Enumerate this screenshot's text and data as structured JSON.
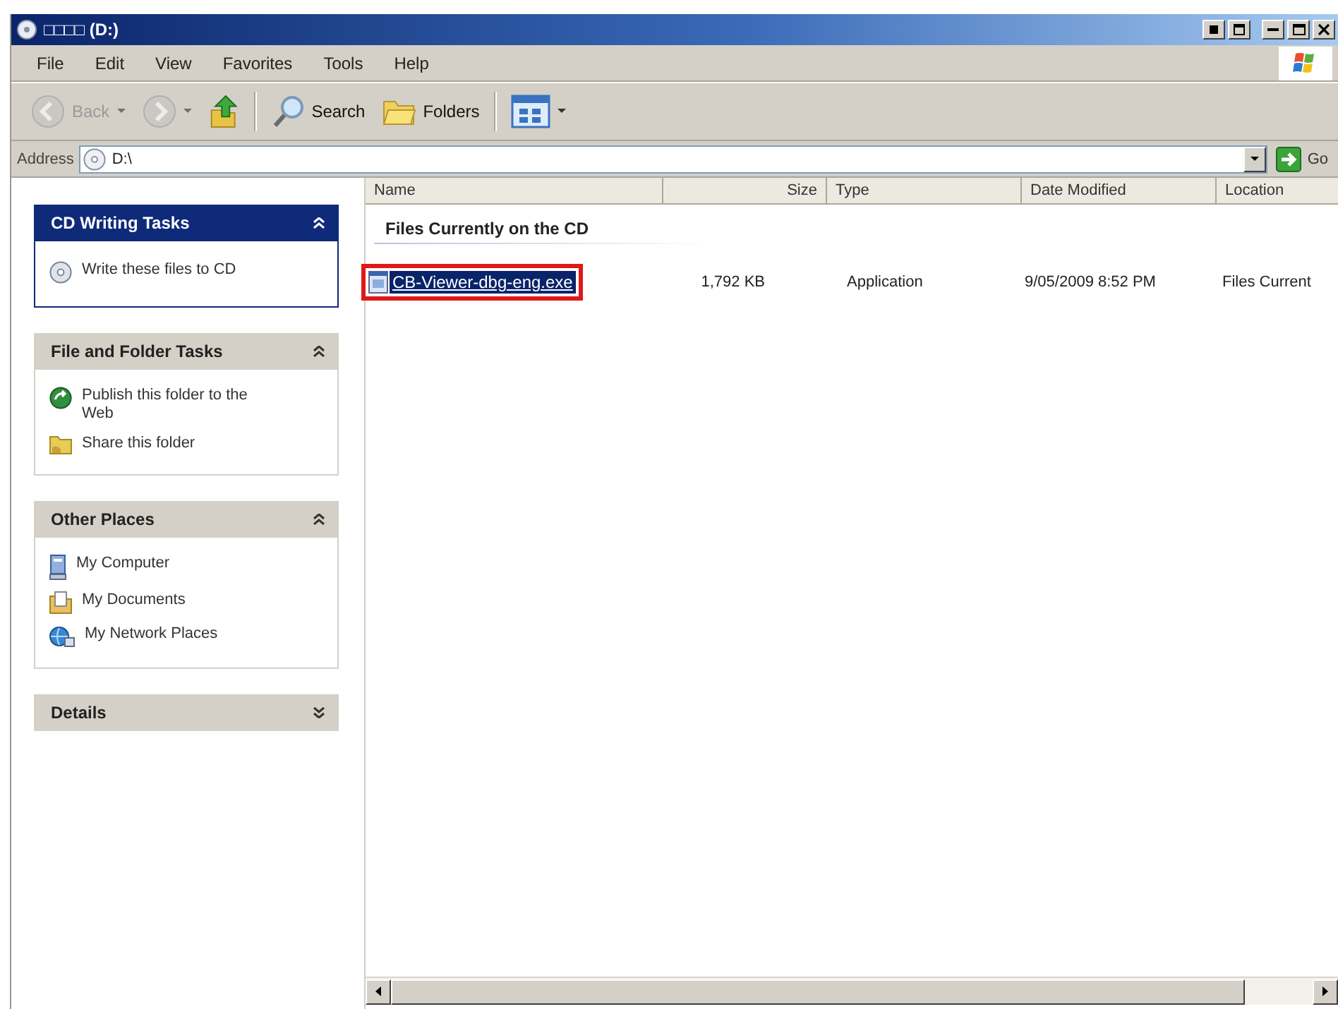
{
  "window": {
    "title": "□□□□ (D:)"
  },
  "menu": [
    "File",
    "Edit",
    "View",
    "Favorites",
    "Tools",
    "Help"
  ],
  "toolbar": [
    {
      "kind": "back",
      "label": "Back",
      "disabled": true
    },
    {
      "kind": "forward",
      "disabled": true
    },
    {
      "kind": "up",
      "disabled": false
    },
    {
      "kind": "search",
      "label": "Search",
      "disabled": false
    },
    {
      "kind": "folders",
      "label": "Folders",
      "disabled": false
    },
    {
      "kind": "views",
      "disabled": false
    }
  ],
  "address": {
    "label": "Address",
    "value": "D:\\",
    "go": "Go"
  },
  "sidebar": {
    "panels": [
      {
        "title": "CD Writing Tasks",
        "special": true,
        "expanded": true,
        "items": [
          {
            "kind": "cd",
            "label": "Write these files to CD"
          }
        ]
      },
      {
        "title": "File and Folder Tasks",
        "special": false,
        "expanded": true,
        "items": [
          {
            "kind": "publish",
            "label": "Publish this folder to the Web"
          },
          {
            "kind": "share",
            "label": "Share this folder"
          }
        ]
      },
      {
        "title": "Other Places",
        "special": false,
        "expanded": true,
        "items": [
          {
            "kind": "computer",
            "label": "My Computer"
          },
          {
            "kind": "documents",
            "label": "My Documents"
          },
          {
            "kind": "network",
            "label": "My Network Places"
          }
        ]
      },
      {
        "title": "Details",
        "special": false,
        "expanded": false
      }
    ]
  },
  "file_list": {
    "columns": [
      "Name",
      "Size",
      "Type",
      "Date Modified",
      "Location"
    ],
    "groups": [
      {
        "title": "Files Currently on the CD",
        "rows": [
          {
            "name": "CB-Viewer-dbg-eng.exe",
            "size": "1,792 KB",
            "type": "Application",
            "date_modified": "9/05/2009 8:52 PM",
            "location": "Files Current",
            "selected": true,
            "highlighted": true
          }
        ]
      }
    ]
  }
}
